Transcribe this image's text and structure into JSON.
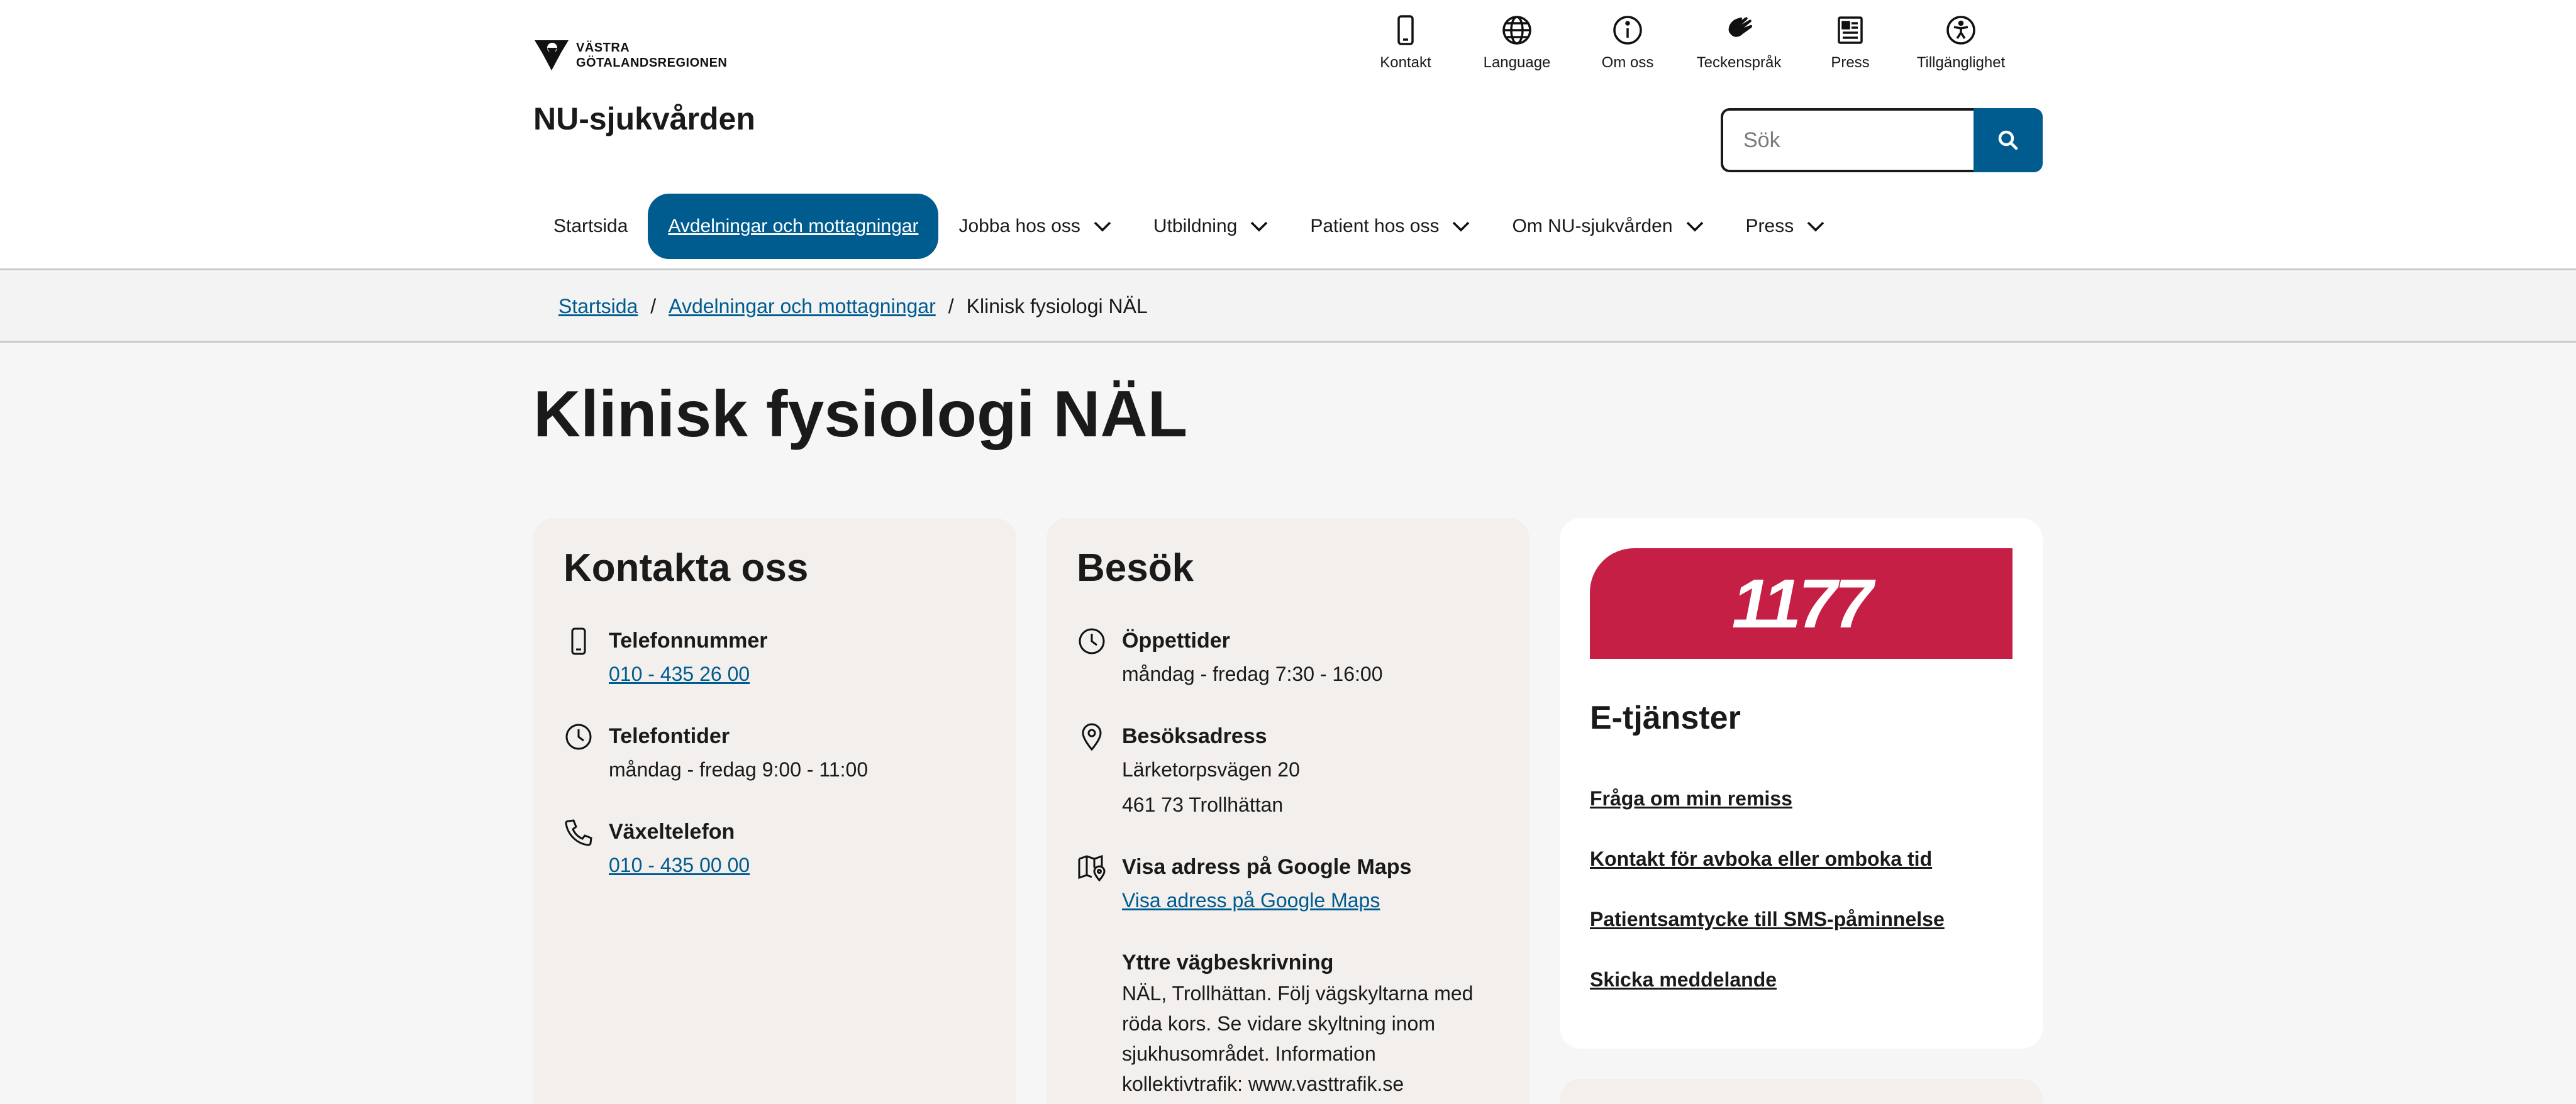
{
  "logo": {
    "line1": "VÄSTRA",
    "line2": "GÖTALANDSREGIONEN"
  },
  "site_title": "NU-sjukvården",
  "util_nav": [
    {
      "label": "Kontakt",
      "icon": "phone-icon"
    },
    {
      "label": "Language",
      "icon": "globe-icon"
    },
    {
      "label": "Om oss",
      "icon": "info-icon"
    },
    {
      "label": "Teckenspråk",
      "icon": "sign-language-icon"
    },
    {
      "label": "Press",
      "icon": "newspaper-icon"
    },
    {
      "label": "Tillgänglighet",
      "icon": "accessibility-icon"
    }
  ],
  "search": {
    "placeholder": "Sök",
    "button_icon": "search-icon"
  },
  "main_nav": [
    {
      "label": "Startsida",
      "dropdown": false
    },
    {
      "label": "Avdelningar och mottagningar",
      "dropdown": false,
      "active": true
    },
    {
      "label": "Jobba hos oss",
      "dropdown": true
    },
    {
      "label": "Utbildning",
      "dropdown": true
    },
    {
      "label": "Patient hos oss",
      "dropdown": true
    },
    {
      "label": "Om NU-sjukvården",
      "dropdown": true
    },
    {
      "label": "Press",
      "dropdown": true
    }
  ],
  "breadcrumb": {
    "items": [
      "Startsida",
      "Avdelningar och mottagningar"
    ],
    "current": "Klinisk fysiologi NÄL",
    "separator": "/"
  },
  "page_title": "Klinisk fysiologi NÄL",
  "contact": {
    "title": "Kontakta oss",
    "phone_label": "Telefonnummer",
    "phone_value": "010 - 435 26 00",
    "hours_label": "Telefontider",
    "hours_value": "måndag - fredag 9:00 - 11:00",
    "switch_label": "Växeltelefon",
    "switch_value": "010 - 435 00 00"
  },
  "visit": {
    "title": "Besök",
    "open_label": "Öppettider",
    "open_value": "måndag - fredag 7:30 - 16:00",
    "address_label": "Besöksadress",
    "address_line1": "Lärketorpsvägen 20",
    "address_line2": "461 73 Trollhättan",
    "maps_label": "Visa adress på Google Maps",
    "maps_link": "Visa adress på Google Maps",
    "directions_label": "Yttre vägbeskrivning",
    "directions_text": "NÄL, Trollhättan. Följ vägskyltarna med röda kors. Se vidare skyltning inom sjukhusområdet. Information kollektivtrafik: www.vasttrafik.se"
  },
  "etjanster": {
    "banner": "1177",
    "title": "E-tjänster",
    "links": [
      "Fråga om min remiss",
      "Kontakt för avboka eller omboka tid",
      "Patientsamtycke till SMS-påminnelse",
      "Skicka meddelande"
    ]
  },
  "colors": {
    "primary": "#005b8f",
    "brand_1177": "#c51f45",
    "card_bg": "#f2efed"
  }
}
